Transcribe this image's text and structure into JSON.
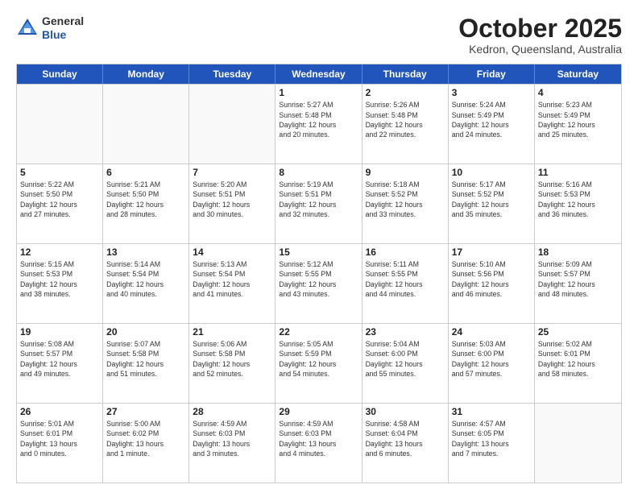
{
  "header": {
    "logo": {
      "text_general": "General",
      "text_blue": "Blue"
    },
    "title": "October 2025",
    "location": "Kedron, Queensland, Australia"
  },
  "weekdays": [
    "Sunday",
    "Monday",
    "Tuesday",
    "Wednesday",
    "Thursday",
    "Friday",
    "Saturday"
  ],
  "rows": [
    [
      {
        "day": "",
        "info": ""
      },
      {
        "day": "",
        "info": ""
      },
      {
        "day": "",
        "info": ""
      },
      {
        "day": "1",
        "info": "Sunrise: 5:27 AM\nSunset: 5:48 PM\nDaylight: 12 hours\nand 20 minutes."
      },
      {
        "day": "2",
        "info": "Sunrise: 5:26 AM\nSunset: 5:48 PM\nDaylight: 12 hours\nand 22 minutes."
      },
      {
        "day": "3",
        "info": "Sunrise: 5:24 AM\nSunset: 5:49 PM\nDaylight: 12 hours\nand 24 minutes."
      },
      {
        "day": "4",
        "info": "Sunrise: 5:23 AM\nSunset: 5:49 PM\nDaylight: 12 hours\nand 25 minutes."
      }
    ],
    [
      {
        "day": "5",
        "info": "Sunrise: 5:22 AM\nSunset: 5:50 PM\nDaylight: 12 hours\nand 27 minutes."
      },
      {
        "day": "6",
        "info": "Sunrise: 5:21 AM\nSunset: 5:50 PM\nDaylight: 12 hours\nand 28 minutes."
      },
      {
        "day": "7",
        "info": "Sunrise: 5:20 AM\nSunset: 5:51 PM\nDaylight: 12 hours\nand 30 minutes."
      },
      {
        "day": "8",
        "info": "Sunrise: 5:19 AM\nSunset: 5:51 PM\nDaylight: 12 hours\nand 32 minutes."
      },
      {
        "day": "9",
        "info": "Sunrise: 5:18 AM\nSunset: 5:52 PM\nDaylight: 12 hours\nand 33 minutes."
      },
      {
        "day": "10",
        "info": "Sunrise: 5:17 AM\nSunset: 5:52 PM\nDaylight: 12 hours\nand 35 minutes."
      },
      {
        "day": "11",
        "info": "Sunrise: 5:16 AM\nSunset: 5:53 PM\nDaylight: 12 hours\nand 36 minutes."
      }
    ],
    [
      {
        "day": "12",
        "info": "Sunrise: 5:15 AM\nSunset: 5:53 PM\nDaylight: 12 hours\nand 38 minutes."
      },
      {
        "day": "13",
        "info": "Sunrise: 5:14 AM\nSunset: 5:54 PM\nDaylight: 12 hours\nand 40 minutes."
      },
      {
        "day": "14",
        "info": "Sunrise: 5:13 AM\nSunset: 5:54 PM\nDaylight: 12 hours\nand 41 minutes."
      },
      {
        "day": "15",
        "info": "Sunrise: 5:12 AM\nSunset: 5:55 PM\nDaylight: 12 hours\nand 43 minutes."
      },
      {
        "day": "16",
        "info": "Sunrise: 5:11 AM\nSunset: 5:55 PM\nDaylight: 12 hours\nand 44 minutes."
      },
      {
        "day": "17",
        "info": "Sunrise: 5:10 AM\nSunset: 5:56 PM\nDaylight: 12 hours\nand 46 minutes."
      },
      {
        "day": "18",
        "info": "Sunrise: 5:09 AM\nSunset: 5:57 PM\nDaylight: 12 hours\nand 48 minutes."
      }
    ],
    [
      {
        "day": "19",
        "info": "Sunrise: 5:08 AM\nSunset: 5:57 PM\nDaylight: 12 hours\nand 49 minutes."
      },
      {
        "day": "20",
        "info": "Sunrise: 5:07 AM\nSunset: 5:58 PM\nDaylight: 12 hours\nand 51 minutes."
      },
      {
        "day": "21",
        "info": "Sunrise: 5:06 AM\nSunset: 5:58 PM\nDaylight: 12 hours\nand 52 minutes."
      },
      {
        "day": "22",
        "info": "Sunrise: 5:05 AM\nSunset: 5:59 PM\nDaylight: 12 hours\nand 54 minutes."
      },
      {
        "day": "23",
        "info": "Sunrise: 5:04 AM\nSunset: 6:00 PM\nDaylight: 12 hours\nand 55 minutes."
      },
      {
        "day": "24",
        "info": "Sunrise: 5:03 AM\nSunset: 6:00 PM\nDaylight: 12 hours\nand 57 minutes."
      },
      {
        "day": "25",
        "info": "Sunrise: 5:02 AM\nSunset: 6:01 PM\nDaylight: 12 hours\nand 58 minutes."
      }
    ],
    [
      {
        "day": "26",
        "info": "Sunrise: 5:01 AM\nSunset: 6:01 PM\nDaylight: 13 hours\nand 0 minutes."
      },
      {
        "day": "27",
        "info": "Sunrise: 5:00 AM\nSunset: 6:02 PM\nDaylight: 13 hours\nand 1 minute."
      },
      {
        "day": "28",
        "info": "Sunrise: 4:59 AM\nSunset: 6:03 PM\nDaylight: 13 hours\nand 3 minutes."
      },
      {
        "day": "29",
        "info": "Sunrise: 4:59 AM\nSunset: 6:03 PM\nDaylight: 13 hours\nand 4 minutes."
      },
      {
        "day": "30",
        "info": "Sunrise: 4:58 AM\nSunset: 6:04 PM\nDaylight: 13 hours\nand 6 minutes."
      },
      {
        "day": "31",
        "info": "Sunrise: 4:57 AM\nSunset: 6:05 PM\nDaylight: 13 hours\nand 7 minutes."
      },
      {
        "day": "",
        "info": ""
      }
    ]
  ]
}
